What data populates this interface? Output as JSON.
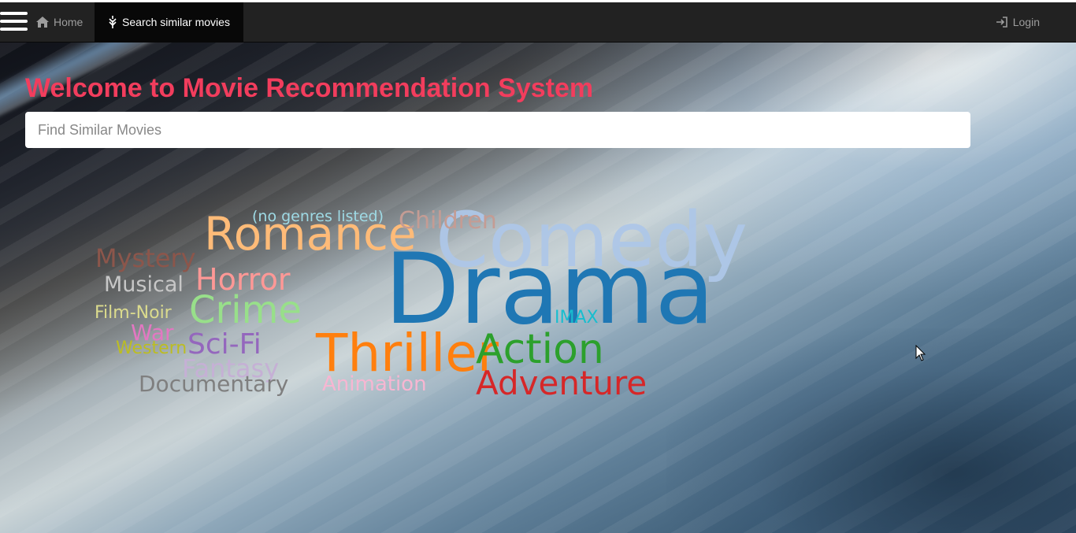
{
  "nav": {
    "home_label": "Home",
    "search_label": "Search similar movies",
    "login_label": "Login"
  },
  "header": {
    "title": "Welcome to Movie Recommendation System",
    "title_color": "#f23d5d"
  },
  "search": {
    "placeholder": "Find Similar Movies",
    "value": ""
  },
  "word_cloud": {
    "words": [
      {
        "text": "Drama",
        "color": "#1f77b4"
      },
      {
        "text": "Comedy",
        "color": "#aec7e8"
      },
      {
        "text": "Romance",
        "color": "#ffbb78"
      },
      {
        "text": "Thriller",
        "color": "#ff7f0e"
      },
      {
        "text": "Action",
        "color": "#2ca02c"
      },
      {
        "text": "Adventure",
        "color": "#d62728"
      },
      {
        "text": "Crime",
        "color": "#98df8a"
      },
      {
        "text": "Horror",
        "color": "#ff9896"
      },
      {
        "text": "Sci-Fi",
        "color": "#9467bd"
      },
      {
        "text": "Fantasy",
        "color": "#c5b0d5"
      },
      {
        "text": "Documentary",
        "color": "#7f7f7f"
      },
      {
        "text": "Animation",
        "color": "#f7b6d2"
      },
      {
        "text": "Children",
        "color": "#c49c94"
      },
      {
        "text": "(no genres listed)",
        "color": "#9edae5"
      },
      {
        "text": "Mystery",
        "color": "#8c564b"
      },
      {
        "text": "Musical",
        "color": "#c7c7c7"
      },
      {
        "text": "Film-Noir",
        "color": "#dbdb8d"
      },
      {
        "text": "War",
        "color": "#e377c2"
      },
      {
        "text": "Western",
        "color": "#bcbd22"
      },
      {
        "text": "IMAX",
        "color": "#17becf"
      }
    ]
  },
  "icons": {
    "menu": "hamburger-menu-icon",
    "home": "home-icon",
    "search": "grain-icon",
    "login": "login-icon"
  }
}
